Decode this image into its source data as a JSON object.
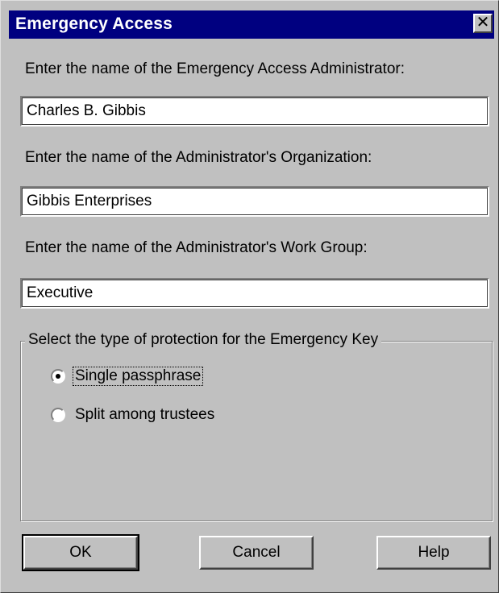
{
  "window": {
    "title": "Emergency Access",
    "close_symbol": "✕"
  },
  "fields": {
    "admin_name": {
      "label": "Enter the name of the Emergency Access Administrator:",
      "value": "Charles B. Gibbis"
    },
    "organization": {
      "label": "Enter the name of the Administrator's Organization:",
      "value": "Gibbis Enterprises"
    },
    "work_group": {
      "label": "Enter the name of the Administrator's Work Group:",
      "value": "Executive"
    }
  },
  "protection": {
    "legend": "Select the type of protection for the Emergency Key",
    "options": [
      {
        "label": "Single passphrase",
        "selected": true
      },
      {
        "label": "Split among trustees",
        "selected": false
      }
    ]
  },
  "buttons": {
    "ok": "OK",
    "cancel": "Cancel",
    "help": "Help"
  },
  "colors": {
    "titlebar": "#000080",
    "face": "#c0c0c0"
  }
}
